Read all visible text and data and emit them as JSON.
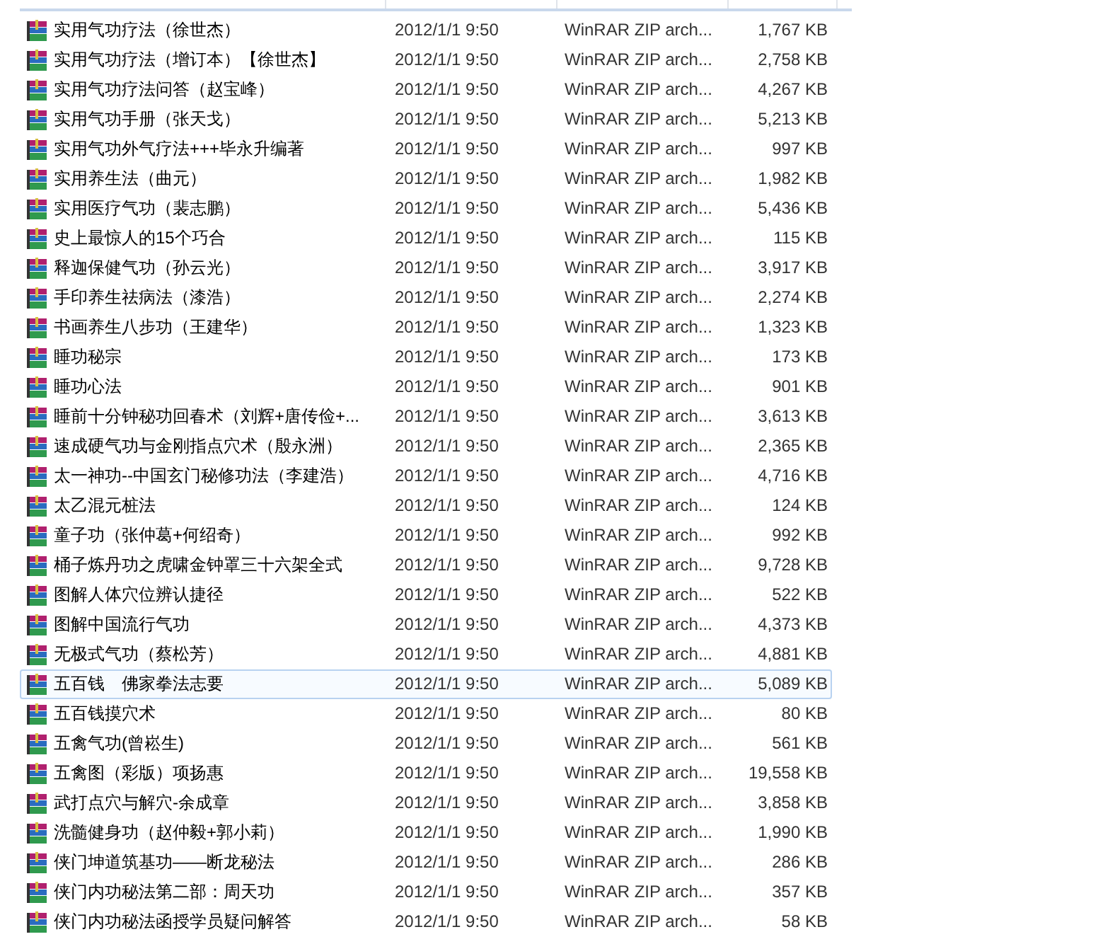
{
  "files": [
    {
      "name": "实用气功疗法（徐世杰）",
      "date": "2012/1/1 9:50",
      "type": "WinRAR ZIP arch...",
      "size": "1,767 KB",
      "selected": false
    },
    {
      "name": "实用气功疗法（增订本）【徐世杰】",
      "date": "2012/1/1 9:50",
      "type": "WinRAR ZIP arch...",
      "size": "2,758 KB",
      "selected": false
    },
    {
      "name": "实用气功疗法问答（赵宝峰）",
      "date": "2012/1/1 9:50",
      "type": "WinRAR ZIP arch...",
      "size": "4,267 KB",
      "selected": false
    },
    {
      "name": "实用气功手册（张天戈）",
      "date": "2012/1/1 9:50",
      "type": "WinRAR ZIP arch...",
      "size": "5,213 KB",
      "selected": false
    },
    {
      "name": "实用气功外气疗法+++毕永升编著",
      "date": "2012/1/1 9:50",
      "type": "WinRAR ZIP arch...",
      "size": "997 KB",
      "selected": false
    },
    {
      "name": "实用养生法（曲元）",
      "date": "2012/1/1 9:50",
      "type": "WinRAR ZIP arch...",
      "size": "1,982 KB",
      "selected": false
    },
    {
      "name": "实用医疗气功（裴志鹏）",
      "date": "2012/1/1 9:50",
      "type": "WinRAR ZIP arch...",
      "size": "5,436 KB",
      "selected": false
    },
    {
      "name": "史上最惊人的15个巧合",
      "date": "2012/1/1 9:50",
      "type": "WinRAR ZIP arch...",
      "size": "115 KB",
      "selected": false
    },
    {
      "name": "释迦保健气功（孙云光）",
      "date": "2012/1/1 9:50",
      "type": "WinRAR ZIP arch...",
      "size": "3,917 KB",
      "selected": false
    },
    {
      "name": "手印养生祛病法（漆浩）",
      "date": "2012/1/1 9:50",
      "type": "WinRAR ZIP arch...",
      "size": "2,274 KB",
      "selected": false
    },
    {
      "name": "书画养生八步功（王建华）",
      "date": "2012/1/1 9:50",
      "type": "WinRAR ZIP arch...",
      "size": "1,323 KB",
      "selected": false
    },
    {
      "name": "睡功秘宗",
      "date": "2012/1/1 9:50",
      "type": "WinRAR ZIP arch...",
      "size": "173 KB",
      "selected": false
    },
    {
      "name": "睡功心法",
      "date": "2012/1/1 9:50",
      "type": "WinRAR ZIP arch...",
      "size": "901 KB",
      "selected": false
    },
    {
      "name": "睡前十分钟秘功回春术（刘辉+唐传俭+...",
      "date": "2012/1/1 9:50",
      "type": "WinRAR ZIP arch...",
      "size": "3,613 KB",
      "selected": false
    },
    {
      "name": "速成硬气功与金刚指点穴术（殷永洲）",
      "date": "2012/1/1 9:50",
      "type": "WinRAR ZIP arch...",
      "size": "2,365 KB",
      "selected": false
    },
    {
      "name": "太一神功--中国玄门秘修功法（李建浩）",
      "date": "2012/1/1 9:50",
      "type": "WinRAR ZIP arch...",
      "size": "4,716 KB",
      "selected": false
    },
    {
      "name": "太乙混元桩法",
      "date": "2012/1/1 9:50",
      "type": "WinRAR ZIP arch...",
      "size": "124 KB",
      "selected": false
    },
    {
      "name": "童子功（张仲葛+何绍奇）",
      "date": "2012/1/1 9:50",
      "type": "WinRAR ZIP arch...",
      "size": "992 KB",
      "selected": false
    },
    {
      "name": "桶子炼丹功之虎啸金钟罩三十六架全式",
      "date": "2012/1/1 9:50",
      "type": "WinRAR ZIP arch...",
      "size": "9,728 KB",
      "selected": false
    },
    {
      "name": "图解人体穴位辨认捷径",
      "date": "2012/1/1 9:50",
      "type": "WinRAR ZIP arch...",
      "size": "522 KB",
      "selected": false
    },
    {
      "name": "图解中国流行气功",
      "date": "2012/1/1 9:50",
      "type": "WinRAR ZIP arch...",
      "size": "4,373 KB",
      "selected": false
    },
    {
      "name": "无极式气功（蔡松芳）",
      "date": "2012/1/1 9:50",
      "type": "WinRAR ZIP arch...",
      "size": "4,881 KB",
      "selected": false
    },
    {
      "name": "五百钱　佛家拳法志要",
      "date": "2012/1/1 9:50",
      "type": "WinRAR ZIP arch...",
      "size": "5,089 KB",
      "selected": true
    },
    {
      "name": "五百钱摸穴术",
      "date": "2012/1/1 9:50",
      "type": "WinRAR ZIP arch...",
      "size": "80 KB",
      "selected": false
    },
    {
      "name": "五禽气功(曾崧生)",
      "date": "2012/1/1 9:50",
      "type": "WinRAR ZIP arch...",
      "size": "561 KB",
      "selected": false
    },
    {
      "name": "五禽图（彩版）项扬惠",
      "date": "2012/1/1 9:50",
      "type": "WinRAR ZIP arch...",
      "size": "19,558 KB",
      "selected": false
    },
    {
      "name": "武打点穴与解穴-余成章",
      "date": "2012/1/1 9:50",
      "type": "WinRAR ZIP arch...",
      "size": "3,858 KB",
      "selected": false
    },
    {
      "name": "洗髓健身功（赵仲毅+郭小莉）",
      "date": "2012/1/1 9:50",
      "type": "WinRAR ZIP arch...",
      "size": "1,990 KB",
      "selected": false
    },
    {
      "name": "侠门坤道筑基功——断龙秘法",
      "date": "2012/1/1 9:50",
      "type": "WinRAR ZIP arch...",
      "size": "286 KB",
      "selected": false
    },
    {
      "name": "侠门内功秘法第二部：周天功",
      "date": "2012/1/1 9:50",
      "type": "WinRAR ZIP arch...",
      "size": "357 KB",
      "selected": false
    },
    {
      "name": "侠门内功秘法函授学员疑问解答",
      "date": "2012/1/1 9:50",
      "type": "WinRAR ZIP arch...",
      "size": "58 KB",
      "selected": false
    }
  ]
}
